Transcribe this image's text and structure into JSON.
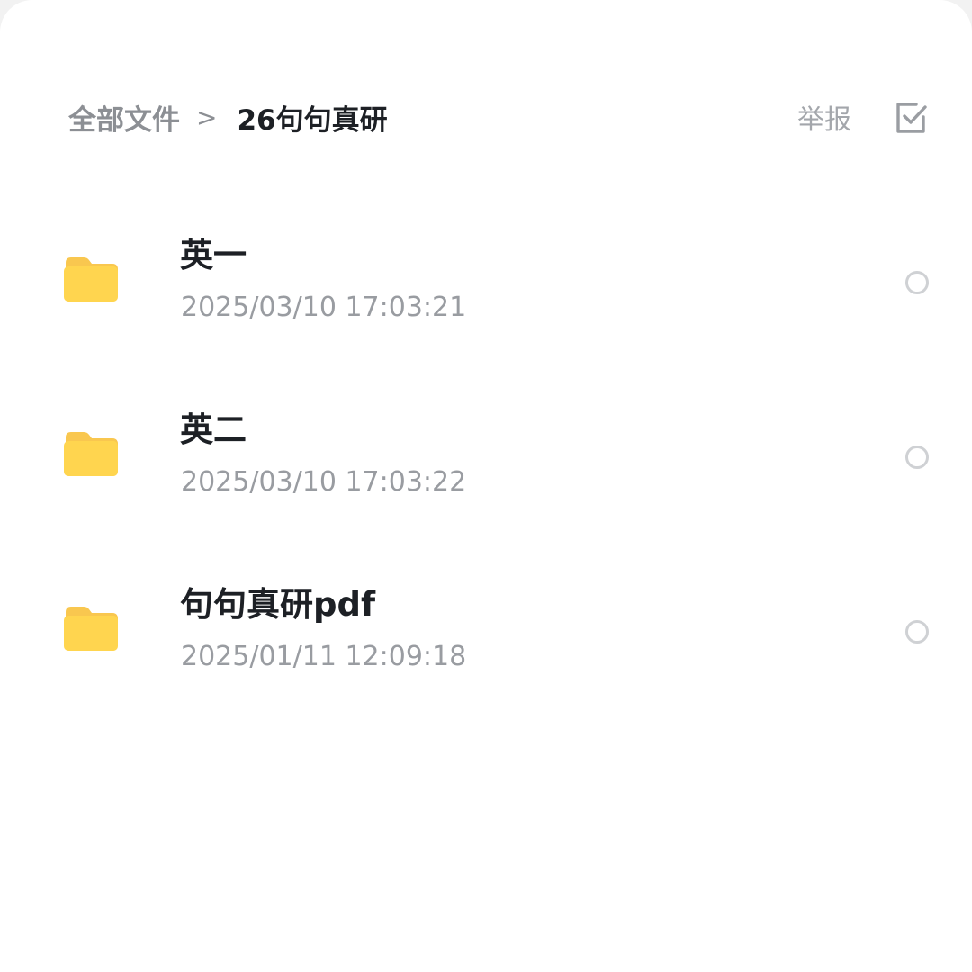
{
  "header": {
    "breadcrumb_root": "全部文件",
    "breadcrumb_separator": ">",
    "breadcrumb_current": "26句句真研",
    "report_label": "举报"
  },
  "files": [
    {
      "name": "英一",
      "modified": "2025/03/10 17:03:21",
      "icon": "folder-icon"
    },
    {
      "name": "英二",
      "modified": "2025/03/10 17:03:22",
      "icon": "folder-icon"
    },
    {
      "name": "句句真研pdf",
      "modified": "2025/01/11 12:09:18",
      "icon": "folder-icon"
    }
  ],
  "colors": {
    "folder": "#FFD54F",
    "folder_tab": "#F9C74F",
    "title_text": "#1D2025",
    "secondary_text": "#999CA1"
  }
}
